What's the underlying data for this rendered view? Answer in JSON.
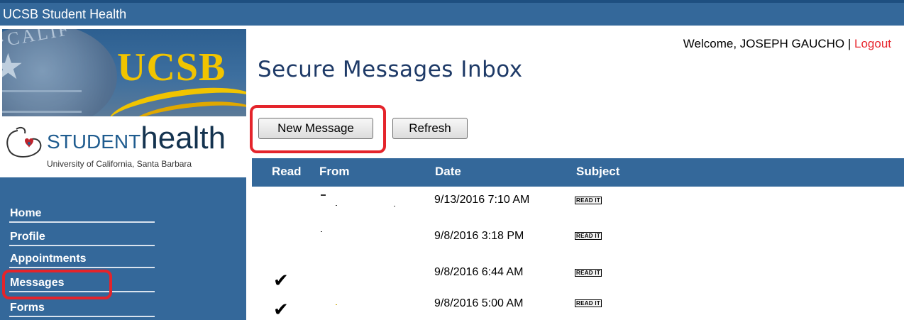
{
  "app": {
    "title": "UCSB Student Health"
  },
  "branding": {
    "seal_text": "OF·CALIF",
    "ucsb": "UCSB",
    "student": "STUDENT",
    "health": "health",
    "university": "University of California, Santa Barbara"
  },
  "header": {
    "welcome": "Welcome, JOSEPH GAUCHO | ",
    "logout": "Logout"
  },
  "page": {
    "title": "Secure Messages Inbox"
  },
  "toolbar": {
    "new_message": "New Message",
    "refresh": "Refresh"
  },
  "sidebar": {
    "items": [
      {
        "label": "Home"
      },
      {
        "label": "Profile"
      },
      {
        "label": "Appointments"
      },
      {
        "label": "Messages"
      },
      {
        "label": "Forms"
      }
    ]
  },
  "table": {
    "columns": {
      "read": "Read",
      "from": "From",
      "date": "Date",
      "subject": "Subject"
    },
    "rows": [
      {
        "read": "",
        "from": "",
        "date": "9/13/2016 7:10 AM",
        "subject": "READ IT"
      },
      {
        "read": "",
        "from": "",
        "date": "9/8/2016 3:18 PM",
        "subject": "READ IT"
      },
      {
        "read": "✔",
        "from": "",
        "date": "9/8/2016 6:44 AM",
        "subject": "READ IT"
      },
      {
        "read": "✔",
        "from": "",
        "date": "9/8/2016 5:00 AM",
        "subject": "READ IT"
      }
    ]
  },
  "colors": {
    "brand_blue": "#34689a",
    "gold": "#f1c400",
    "highlight_red": "#e4242b",
    "logout_red": "#e8262e"
  }
}
